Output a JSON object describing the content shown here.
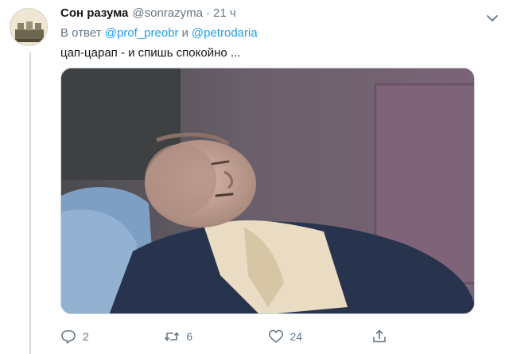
{
  "tweet": {
    "display_name": "Сон разума",
    "handle": "@sonrazyma",
    "separator": "·",
    "time": "21 ч",
    "reply_prefix": "В ответ",
    "mentions": [
      "@prof_preobr",
      "@petrodaria"
    ],
    "reply_conjunction": "и",
    "text": "цап-царап - и спишь спокойно ..."
  },
  "actions": {
    "reply_count": "2",
    "retweet_count": "6",
    "like_count": "24",
    "share_count": ""
  },
  "colors": {
    "link": "#1da1f2",
    "secondary_text": "#657786",
    "border": "#ccd6dd"
  },
  "icons": [
    "caret-down-icon",
    "reply-icon",
    "retweet-icon",
    "like-icon",
    "share-icon"
  ]
}
